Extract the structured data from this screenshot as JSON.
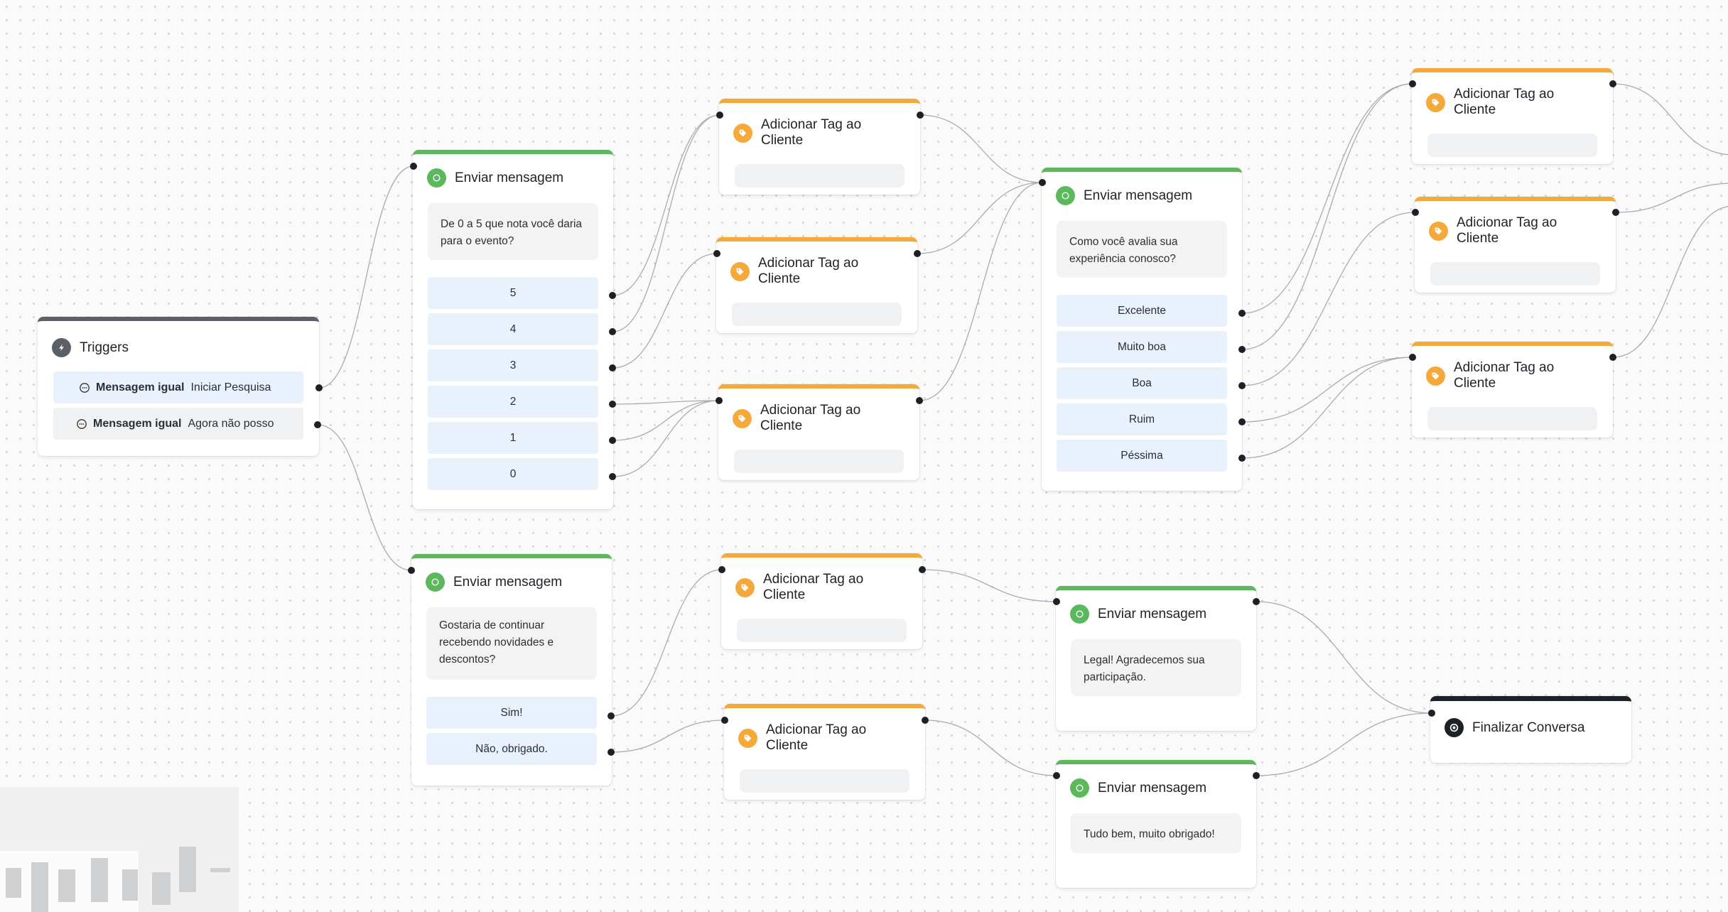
{
  "canvas": {
    "background": "#fafafa",
    "dot_color": "#d4d4d8"
  },
  "colors": {
    "message_accent": "#5cb85c",
    "tag_accent": "#f5a93b",
    "trigger_accent": "#5b5f66",
    "end_accent": "#1d2027",
    "option_bg": "#e9f1fd"
  },
  "triggers": {
    "title": "Triggers",
    "icon": "flash-icon",
    "rows": [
      {
        "label": "Mensagem igual",
        "value": "Iniciar Pesquisa",
        "icon": "chat-bubble-icon"
      },
      {
        "label": "Mensagem igual",
        "value": "Agora não posso",
        "icon": "chat-bubble-icon"
      }
    ]
  },
  "msg1": {
    "title": "Enviar mensagem",
    "text": "De 0 a 5 que nota você daria para o evento?",
    "options": [
      "5",
      "4",
      "3",
      "2",
      "1",
      "0"
    ]
  },
  "msg2": {
    "title": "Enviar mensagem",
    "text": "Gostaria de continuar recebendo novidades e descontos?",
    "options": [
      "Sim!",
      "Não, obrigado."
    ]
  },
  "msg3": {
    "title": "Enviar mensagem",
    "text": "Como você avalia sua experiência conosco?",
    "options": [
      "Excelente",
      "Muito boa",
      "Boa",
      "Ruim",
      "Péssima"
    ]
  },
  "msg4": {
    "title": "Enviar mensagem",
    "text": "Legal! Agradecemos sua participação."
  },
  "msg5": {
    "title": "Enviar mensagem",
    "text": "Tudo bem, muito obrigado!"
  },
  "tags": {
    "tag1": {
      "title": "Adicionar Tag ao Cliente"
    },
    "tag2": {
      "title": "Adicionar Tag ao Cliente"
    },
    "tag3": {
      "title": "Adicionar Tag ao Cliente"
    },
    "tag4": {
      "title": "Adicionar Tag ao Cliente"
    },
    "tag5": {
      "title": "Adicionar Tag ao Cliente"
    },
    "tag6": {
      "title": "Adicionar Tag ao Cliente"
    },
    "tag7": {
      "title": "Adicionar Tag ao Cliente"
    },
    "tag8": {
      "title": "Adicionar Tag ao Cliente"
    }
  },
  "end": {
    "title": "Finalizar Conversa",
    "icon": "stop-circle-icon"
  }
}
